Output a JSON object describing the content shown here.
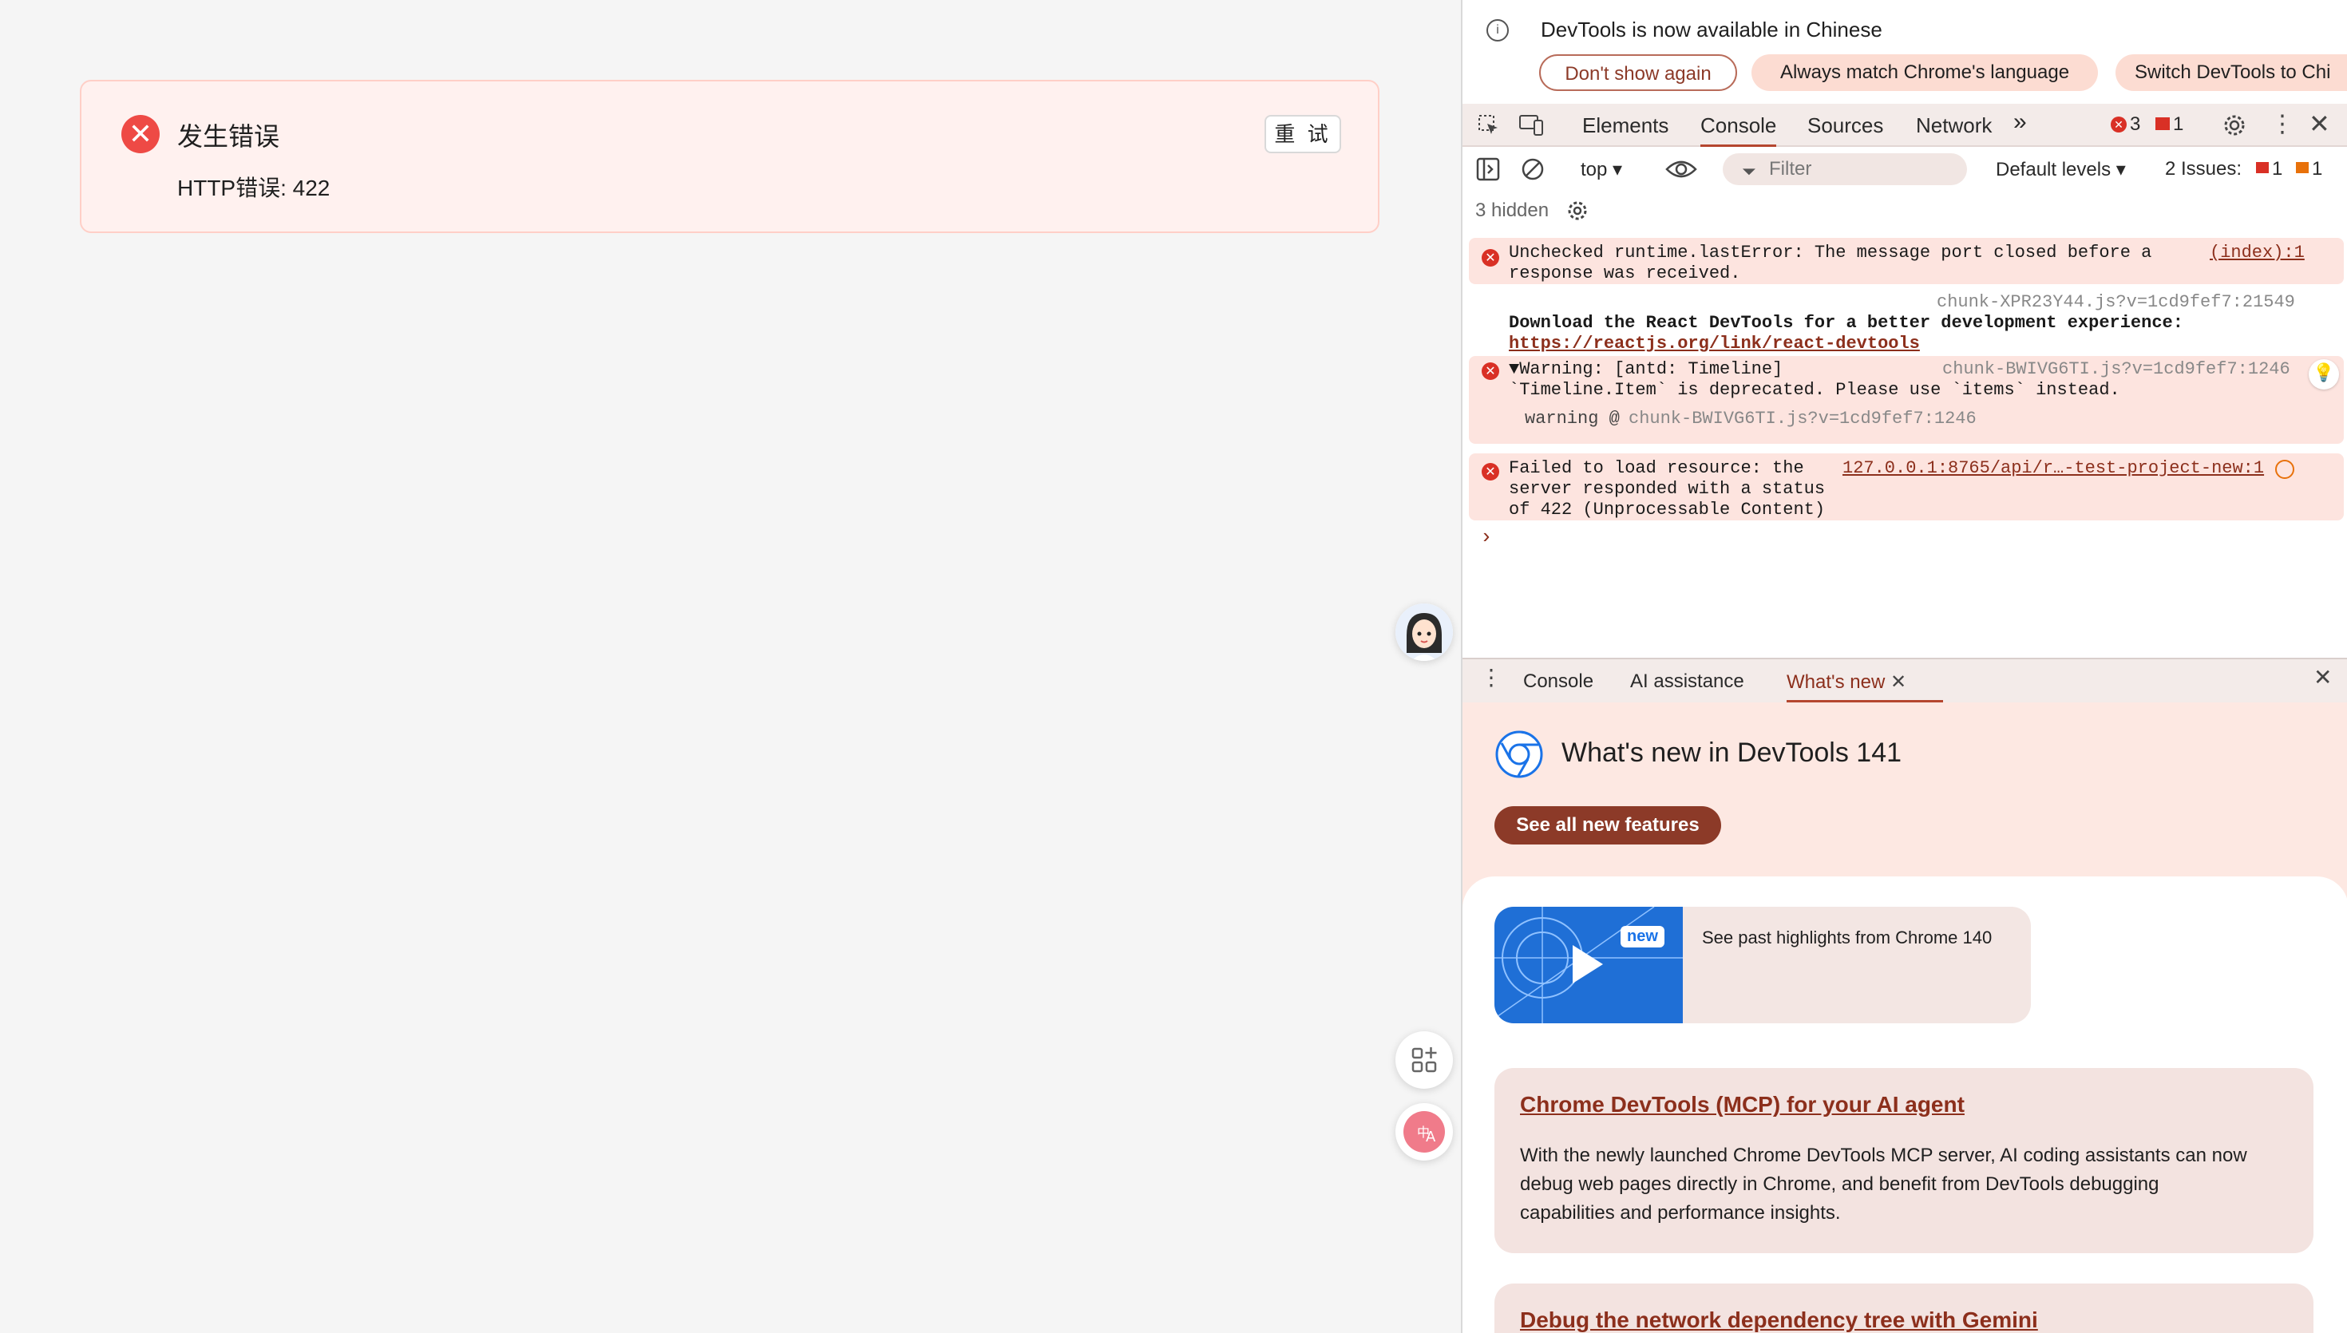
{
  "error_card": {
    "title": "发生错误",
    "message": "HTTP错误: 422",
    "retry_label": "重 试",
    "icon": "close-circle-icon"
  },
  "floating": {
    "avatar": "avatar",
    "grid_icon": "app-grid-add-icon",
    "translate_icon": "translate-icon"
  },
  "devtools": {
    "banner": {
      "text": "DevTools is now available in Chinese",
      "dont_show": "Don't show again",
      "always_match": "Always match Chrome's language",
      "switch": "Switch DevTools to Chi"
    },
    "tabs": [
      "Elements",
      "Console",
      "Sources",
      "Network"
    ],
    "error_count": "3",
    "issue_count": "1",
    "filter": {
      "context": "top",
      "placeholder": "Filter",
      "levels": "Default levels",
      "issues_label": "2 Issues:",
      "issues_err": "1",
      "issues_warn": "1"
    },
    "hidden_label": "3 hidden",
    "messages": {
      "m1_text_1": "Unchecked runtime.lastError: The message port closed before a",
      "m1_text_2": "response was received.",
      "m1_src": "(index):1",
      "m2_src": "chunk-XPR23Y44.js?v=1cd9fef7:21549",
      "m2_text": "Download the React DevTools for a better development experience:",
      "m2_link": "https://reactjs.org/link/react-devtools",
      "m3_text_1": "▼Warning: [antd: Timeline]",
      "m3_src": "chunk-BWIVG6TI.js?v=1cd9fef7:1246",
      "m3_text_2": "`Timeline.Item` is deprecated. Please use `items` instead.",
      "m3_trace_label": "warning @ ",
      "m3_trace_src": "chunk-BWIVG6TI.js?v=1cd9fef7:1246",
      "m4_text_1": "Failed to load resource: the",
      "m4_text_2": "server responded with a status",
      "m4_text_3": "of 422 (Unprocessable Content)",
      "m4_src": "127.0.0.1:8765/api/r…-test-project-new:1"
    },
    "prompt": "›",
    "drawer": {
      "tabs": [
        "Console",
        "AI assistance",
        "What's new"
      ]
    },
    "whats_new": {
      "title": "What's new in DevTools 141",
      "see_all": "See all new features",
      "video_badge": "new",
      "video_text": "See past highlights from Chrome 140",
      "card1_title": "Chrome DevTools (MCP) for your AI agent",
      "card1_body_1": "With the newly launched Chrome DevTools MCP server, AI coding assistants can now",
      "card1_body_2": "debug web pages directly in Chrome, and benefit from DevTools debugging",
      "card1_body_3": "capabilities and performance insights.",
      "card2_title": "Debug the network dependency tree with Gemini"
    }
  },
  "colors": {
    "error_red": "#ee4a45",
    "accent": "#8c3a28",
    "devtools_tint": "#fde8e2"
  }
}
